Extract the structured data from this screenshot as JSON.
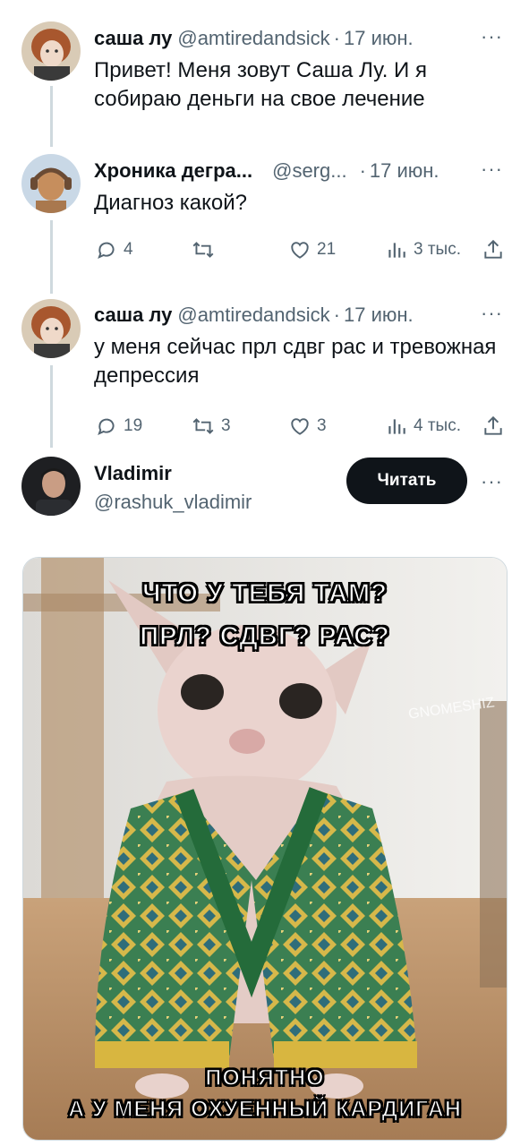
{
  "tweets": [
    {
      "name": "саша лу",
      "handle": "@amtiredandsick",
      "sep": "·",
      "date": "17 июн.",
      "text_lines": [
        "Привет! Меня зовут Саша Лу. И я",
        "собираю деньги на свое лечение"
      ]
    },
    {
      "name": "Хроника дегра...",
      "handle": "@serg...",
      "sep": "·",
      "date": "17 июн.",
      "text_lines": [
        "Диагноз какой?"
      ],
      "actions": {
        "replies": "4",
        "retweets": "",
        "likes": "21",
        "views": "3 тыс."
      }
    },
    {
      "name": "саша лу",
      "handle": "@amtiredandsick",
      "sep": "·",
      "date": "17 июн.",
      "text_lines": [
        "у меня сейчас прл сдвг рас и тревожная",
        "депрессия"
      ],
      "actions": {
        "replies": "19",
        "retweets": "3",
        "likes": "3",
        "views": "4 тыс."
      }
    }
  ],
  "more_label": "···",
  "profile": {
    "name": "Vladimir",
    "handle": "@rashuk_vladimir",
    "follow_label": "Читать",
    "more_label": "···"
  },
  "meme": {
    "top_line_1": "ЧТО У ТЕБЯ ТАМ?",
    "top_line_2": "ПРЛ? СДВГ? РАС?",
    "bottom_line_1": "ПОНЯТНО",
    "bottom_line_2": "А У МЕНЯ ОХУЕННЫЙ КАРДИГАН",
    "watermark": "GNOMESHIZ"
  },
  "colors": {
    "text": "#0f1419",
    "muted": "#536471",
    "line": "#cfd9de",
    "button": "#0f1419"
  }
}
